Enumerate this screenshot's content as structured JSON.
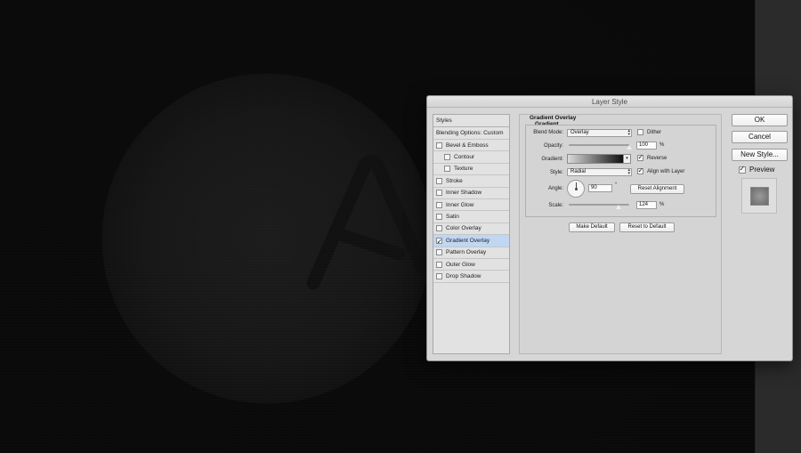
{
  "dialog": {
    "title": "Layer Style"
  },
  "styles_list": {
    "header": "Styles",
    "blending": "Blending Options: Custom",
    "items": [
      {
        "label": "Bevel & Emboss",
        "checked": false,
        "indent": false,
        "selected": false
      },
      {
        "label": "Contour",
        "checked": false,
        "indent": true,
        "selected": false
      },
      {
        "label": "Texture",
        "checked": false,
        "indent": true,
        "selected": false
      },
      {
        "label": "Stroke",
        "checked": false,
        "indent": false,
        "selected": false
      },
      {
        "label": "Inner Shadow",
        "checked": false,
        "indent": false,
        "selected": false
      },
      {
        "label": "Inner Glow",
        "checked": false,
        "indent": false,
        "selected": false
      },
      {
        "label": "Satin",
        "checked": false,
        "indent": false,
        "selected": false
      },
      {
        "label": "Color Overlay",
        "checked": false,
        "indent": false,
        "selected": false
      },
      {
        "label": "Gradient Overlay",
        "checked": true,
        "indent": false,
        "selected": true
      },
      {
        "label": "Pattern Overlay",
        "checked": false,
        "indent": false,
        "selected": false
      },
      {
        "label": "Outer Glow",
        "checked": false,
        "indent": false,
        "selected": false
      },
      {
        "label": "Drop Shadow",
        "checked": false,
        "indent": false,
        "selected": false
      }
    ]
  },
  "gradient_overlay": {
    "section_title": "Gradient Overlay",
    "group_title": "Gradient",
    "blend_mode_label": "Blend Mode:",
    "blend_mode_value": "Overlay",
    "dither_label": "Dither",
    "dither_checked": false,
    "opacity_label": "Opacity:",
    "opacity_value": "100",
    "opacity_fraction": 1.0,
    "percent": "%",
    "gradient_label": "Gradient:",
    "reverse_label": "Reverse",
    "reverse_checked": true,
    "style_label": "Style:",
    "style_value": "Radial",
    "align_label": "Align with Layer",
    "align_checked": true,
    "angle_label": "Angle:",
    "angle_value": "90",
    "degree": "°",
    "reset_alignment_label": "Reset Alignment",
    "scale_label": "Scale:",
    "scale_value": "124",
    "scale_fraction": 0.82,
    "make_default_label": "Make Default",
    "reset_default_label": "Reset to Default"
  },
  "actions": {
    "ok_label": "OK",
    "cancel_label": "Cancel",
    "new_style_label": "New Style...",
    "preview_label": "Preview",
    "preview_checked": true
  },
  "canvas": {
    "logo_letter": "A"
  },
  "colors": {
    "dialog_bg": "#d6d6d6",
    "selected_row": "#bfd7f3",
    "canvas_bg": "#0d0d0d"
  },
  "icons": {
    "checkmark": "check-icon",
    "select_arrows": "updown-arrows-icon",
    "dropdown": "chevron-down-icon"
  }
}
